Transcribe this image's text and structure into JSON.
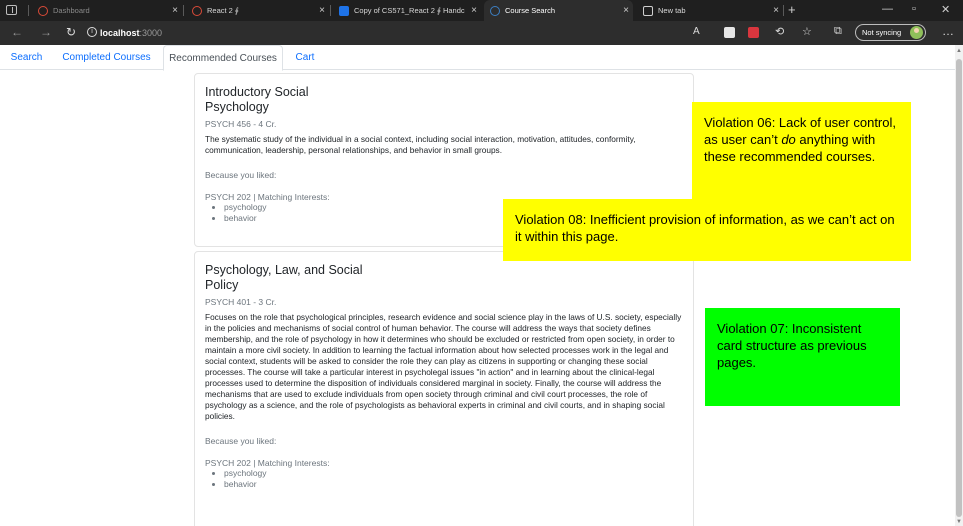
{
  "browser": {
    "tabs": [
      {
        "title": "Dashboard"
      },
      {
        "title": "React 2 ∮"
      },
      {
        "title": "Copy of CS571_React 2 ∮ Handc"
      },
      {
        "title": "Course Search"
      },
      {
        "title": "New tab"
      }
    ],
    "close_glyph": "×",
    "new_tab_glyph": "+",
    "url_host": "localhost",
    "url_port": ":3000",
    "sync_label": "Not syncing"
  },
  "nav": {
    "tabs": [
      "Search",
      "Completed Courses",
      "Recommended Courses",
      "Cart"
    ],
    "active_index": 2
  },
  "courses": [
    {
      "title": "Introductory Social Psychology",
      "subtitle": "PSYCH 456 - 4 Cr.",
      "description": "The systematic study of the individual in a social context, including social interaction, motivation, attitudes, conformity, communication, leadership, personal relationships, and behavior in small groups.",
      "because_label": "Because you liked:",
      "matching": "PSYCH 202 | Matching Interests:",
      "interests": [
        "psychology",
        "behavior"
      ]
    },
    {
      "title": "Psychology, Law, and Social Policy",
      "subtitle": "PSYCH 401 - 3 Cr.",
      "description": "Focuses on the role that psychological principles, research evidence and social science play in the laws of U.S. society, especially in the policies and mechanisms of social control of human behavior. The course will address the ways that society defines membership, and the role of psychology in how it determines who should be excluded or restricted from open society, in order to maintain a more civil society. In addition to learning the factual information about how selected processes work in the legal and social context, students will be asked to consider the role they can play as citizens in supporting or changing these social processes. The course will take a particular interest in psycholegal issues \"in action\" and in learning about the clinical-legal processes used to determine the disposition of individuals considered marginal in society. Finally, the course will address the mechanisms that are used to exclude individuals from open society through criminal and civil court processes, the role of psychology as a science, and the role of psychologists as behavioral experts in criminal and civil courts, and in shaping social policies.",
      "because_label": "Because you liked:",
      "matching": "PSYCH 202 | Matching Interests:",
      "interests": [
        "psychology",
        "behavior"
      ]
    }
  ],
  "annotations": {
    "v06_pre": "Violation 06: Lack of user control, as user can’t ",
    "v06_em": "do",
    "v06_post": " anything with these recommended courses.",
    "v08": "Violation 08: Inefficient provision of information, as we can’t act on it within this page.",
    "v07": "Violation 07: Inconsistent card structure as previous pages."
  },
  "colors": {
    "link": "#0d6efd",
    "muted": "#6c757d",
    "note_yellow": "#ffff00",
    "note_green": "#00ff00"
  }
}
